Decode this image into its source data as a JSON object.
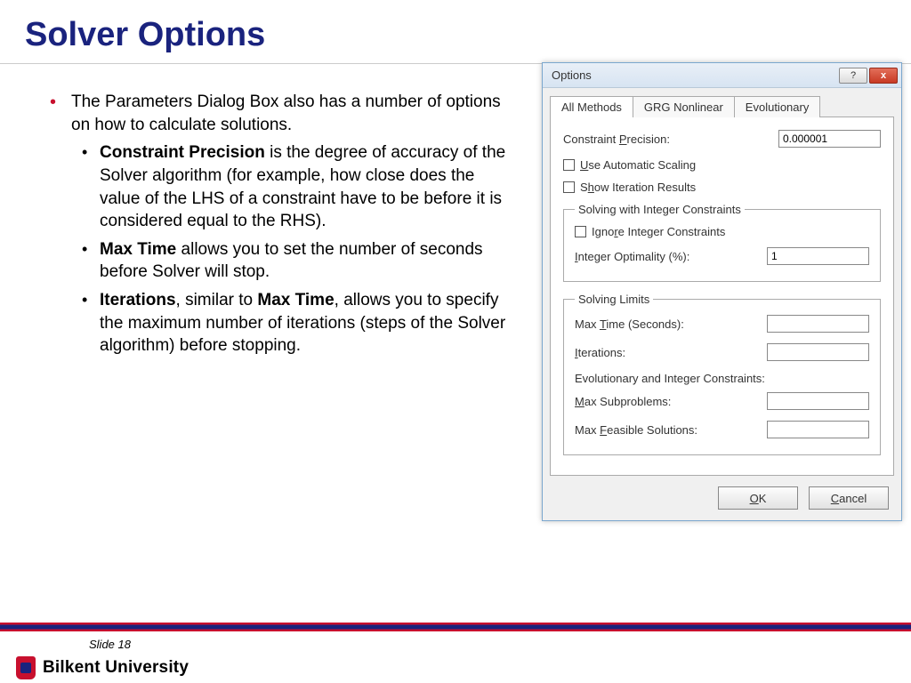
{
  "slide": {
    "title": "Solver Options",
    "number_label": "Slide 18",
    "university": "Bilkent University"
  },
  "bullets": {
    "intro": "The Parameters Dialog Box also has a number of options on how to calculate solutions.",
    "cp_bold": "Constraint Precision",
    "cp_rest": " is the degree of accuracy of the Solver algorithm (for example, how close does the value of the LHS of a constraint have to be before it is considered equal to the RHS).",
    "mt_bold": "Max Time",
    "mt_rest": " allows you to set the number of seconds before Solver will stop.",
    "it_bold1": "Iterations",
    "it_mid": ", similar to ",
    "it_bold2": "Max Time",
    "it_rest": ", allows you to specify the maximum number of iterations (steps of the Solver algorithm) before stopping."
  },
  "dialog": {
    "title": "Options",
    "help_glyph": "?",
    "close_glyph": "x",
    "tabs": {
      "t1": "All Methods",
      "t2": "GRG Nonlinear",
      "t3": "Evolutionary"
    },
    "labels": {
      "constraint_precision_pre": "Constraint ",
      "constraint_precision_u": "P",
      "constraint_precision_post": "recision:",
      "auto_scale_u": "U",
      "auto_scale_post": "se Automatic Scaling",
      "show_iter_pre": "S",
      "show_iter_u": "h",
      "show_iter_post": "ow Iteration Results",
      "group_int": "Solving with Integer Constraints",
      "ignore_int_pre": "Igno",
      "ignore_int_u": "r",
      "ignore_int_post": "e Integer Constraints",
      "int_opt_u": "I",
      "int_opt_post": "nteger Optimality (%):",
      "group_limits": "Solving Limits",
      "max_time_pre": "Max ",
      "max_time_u": "T",
      "max_time_post": "ime (Seconds):",
      "iterations_u": "I",
      "iterations_post": "terations:",
      "evol_head": "Evolutionary and Integer Constraints:",
      "max_sub_u": "M",
      "max_sub_post": "ax Subproblems:",
      "max_feas_pre": "Max ",
      "max_feas_u": "F",
      "max_feas_post": "easible Solutions:",
      "ok_u": "O",
      "ok_post": "K",
      "cancel_u": "C",
      "cancel_post": "ancel"
    },
    "values": {
      "constraint_precision": "0.000001",
      "integer_optimality": "1",
      "max_time": "",
      "iterations": "",
      "max_subproblems": "",
      "max_feasible": ""
    }
  }
}
